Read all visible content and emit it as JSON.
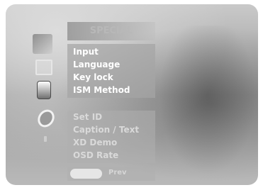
{
  "menu": {
    "title": "SPECIAL",
    "group1": [
      "Input",
      "Language",
      "Key lock",
      "ISM Method"
    ],
    "group2": [
      "Set ID",
      "Caption / Text",
      "XD Demo",
      "OSD Rate"
    ]
  },
  "footer": {
    "prev_label": "Prev"
  },
  "icons": [
    "picture-icon",
    "screen-icon",
    "special-icon",
    "option-icon",
    "tv-icon"
  ]
}
